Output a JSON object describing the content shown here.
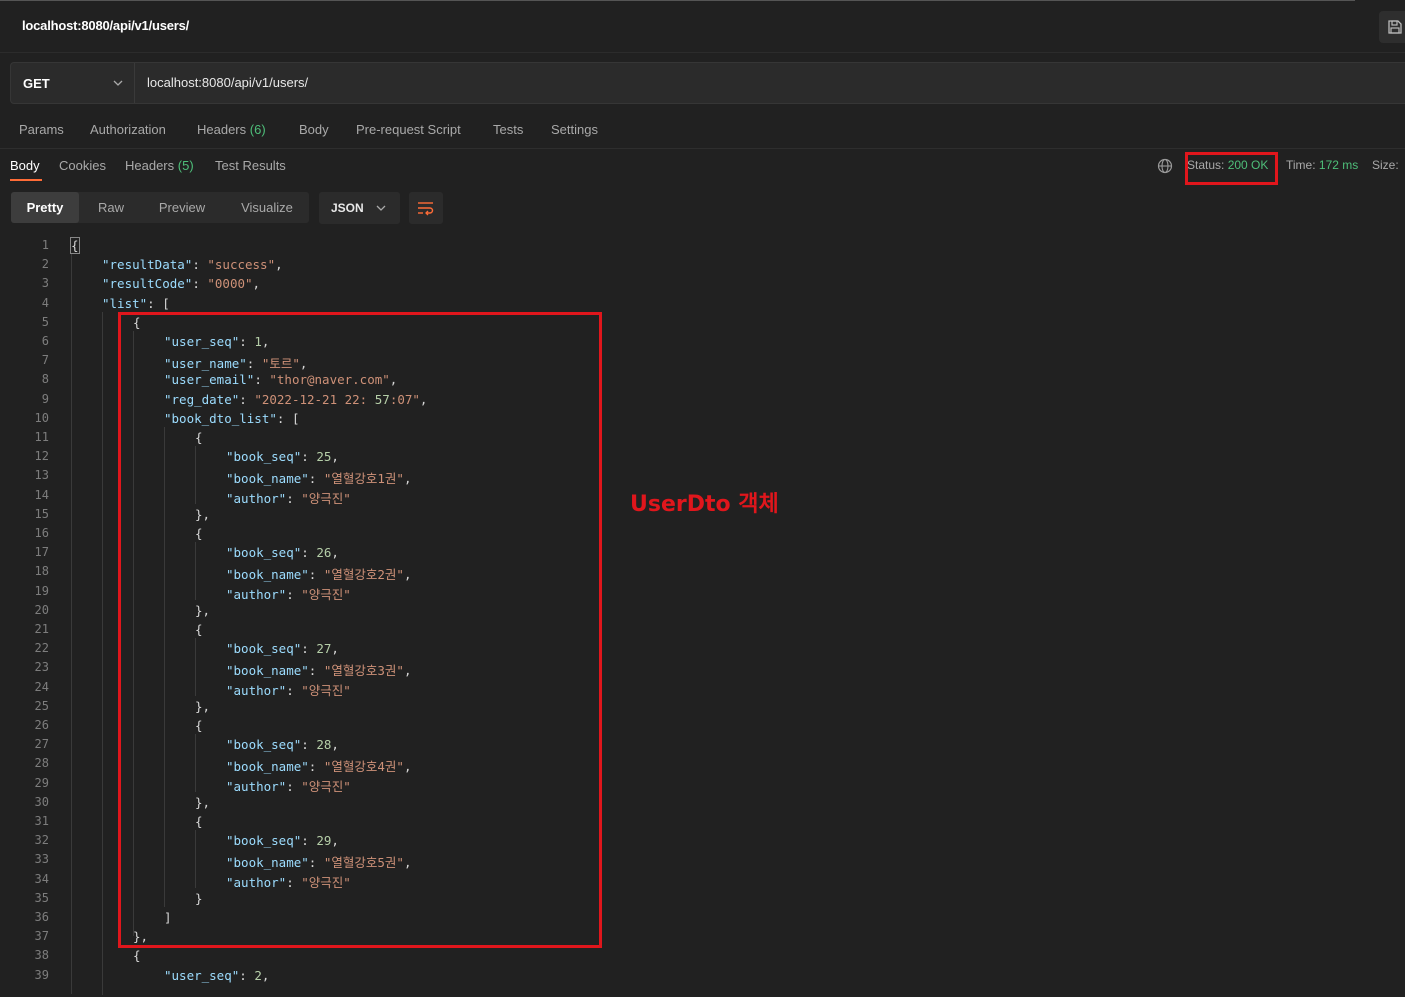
{
  "tab": {
    "title": "localhost:8080/api/v1/users/"
  },
  "request": {
    "method": "GET",
    "url": "localhost:8080/api/v1/users/",
    "tabs": [
      "Params",
      "Authorization",
      "Headers",
      "Body",
      "Pre-request Script",
      "Tests",
      "Settings"
    ],
    "headers_count": "(6)"
  },
  "response": {
    "tabs": [
      "Body",
      "Cookies",
      "Headers",
      "Test Results"
    ],
    "headers_count": "(5)",
    "status_label": "Status:",
    "status_value": "200 OK",
    "time_label": "Time:",
    "time_value": "172 ms",
    "size_label": "Size:",
    "view_modes": [
      "Pretty",
      "Raw",
      "Preview",
      "Visualize"
    ],
    "format": "JSON"
  },
  "annotation": {
    "label": "UserDto 객체"
  },
  "code_lines": [
    "{",
    "    \"resultData\": \"success\",",
    "    \"resultCode\": \"0000\",",
    "    \"list\": [",
    "        {",
    "            \"user_seq\": 1,",
    "            \"user_name\": \"토르\",",
    "            \"user_email\": \"thor@naver.com\",",
    "            \"reg_date\": \"2022-12-21 22:57:07\",",
    "            \"book_dto_list\": [",
    "                {",
    "                    \"book_seq\": 25,",
    "                    \"book_name\": \"열혈강호1권\",",
    "                    \"author\": \"양극진\"",
    "                },",
    "                {",
    "                    \"book_seq\": 26,",
    "                    \"book_name\": \"열혈강호2권\",",
    "                    \"author\": \"양극진\"",
    "                },",
    "                {",
    "                    \"book_seq\": 27,",
    "                    \"book_name\": \"열혈강호3권\",",
    "                    \"author\": \"양극진\"",
    "                },",
    "                {",
    "                    \"book_seq\": 28,",
    "                    \"book_name\": \"열혈강호4권\",",
    "                    \"author\": \"양극진\"",
    "                },",
    "                {",
    "                    \"book_seq\": 29,",
    "                    \"book_name\": \"열혈강호5권\",",
    "                    \"author\": \"양극진\"",
    "                }",
    "            ]",
    "        },",
    "        {",
    "            \"user_seq\": 2,"
  ],
  "colors": {
    "accent": "#ff6c37",
    "success": "#4ebe79",
    "annotation": "#e0161c"
  }
}
